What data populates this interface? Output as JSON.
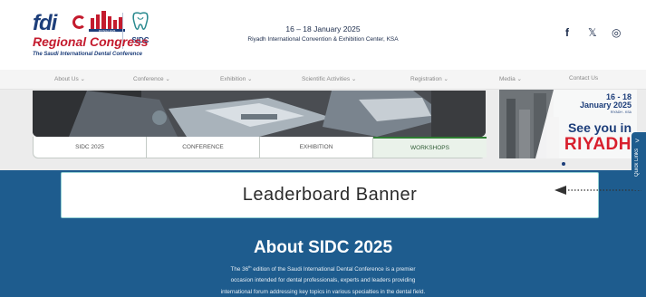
{
  "header": {
    "logo": {
      "fdi": "fdi",
      "year": "RIYADH 2025",
      "sidc": "SIDC",
      "regional": "Regional Congress",
      "tagline": "The Saudi International Dental Conference"
    },
    "event_date": "16 – 18 January 2025",
    "event_venue": "Riyadh International Convention & Exhibition Center, KSA",
    "social": [
      {
        "icon": "facebook-icon",
        "glyph": "f"
      },
      {
        "icon": "x-icon",
        "glyph": "𝕏"
      },
      {
        "icon": "instagram-icon",
        "glyph": "◎"
      }
    ]
  },
  "nav": {
    "items": [
      {
        "label": "About Us ⌄"
      },
      {
        "label": "Conference ⌄"
      },
      {
        "label": "Exhibition ⌄"
      },
      {
        "label": "Scientific Activities ⌄"
      },
      {
        "label": "Registration ⌄"
      },
      {
        "label": "Media ⌄"
      },
      {
        "label": "Contact Us"
      }
    ]
  },
  "tabs": [
    {
      "label": "SIDC 2025",
      "active": false
    },
    {
      "label": "CONFERENCE",
      "active": false
    },
    {
      "label": "EXHIBITION",
      "active": false
    },
    {
      "label": "WORKSHOPS",
      "active": true
    }
  ],
  "ad": {
    "date_line1": "16 - 18",
    "date_line2": "January 2025",
    "location": "RIYADH - KSA",
    "see_you_in": "See you in",
    "city": "RIYADH"
  },
  "leaderboard": {
    "label": "Leaderboard Banner"
  },
  "quick_links": {
    "label": "Quick Links",
    "chevron": ">"
  },
  "about": {
    "title": "About SIDC 2025",
    "line1_pre": "The 36",
    "line1_sup": "th",
    "line1_post": " edition of the Saudi International Dental Conference is a premier",
    "line2": "occasion intended for dental professionals, experts and leaders providing",
    "line3": "international forum addressing key topics in various specialties in the dental field."
  },
  "colors": {
    "brand_navy": "#1d3e7a",
    "brand_red": "#c41b2e",
    "about_bg": "#1e5c8e",
    "tab_active_accent": "#2e7d32"
  }
}
